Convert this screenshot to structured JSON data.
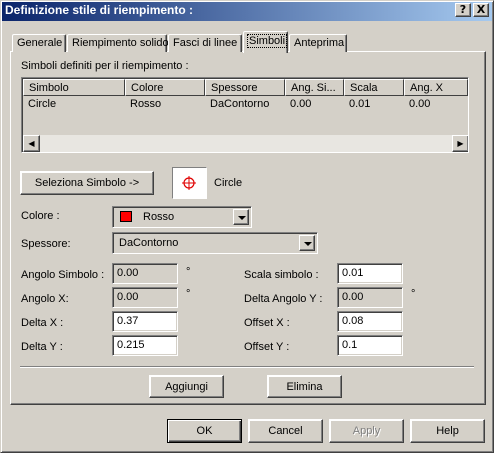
{
  "window": {
    "title": "Definizione stile di riempimento :",
    "help_caption": "?",
    "close_caption": "X"
  },
  "tabs": [
    {
      "label": "Generale"
    },
    {
      "label": "Riempimento solido"
    },
    {
      "label": "Fasci di linee"
    },
    {
      "label": "Simboli",
      "active": true
    },
    {
      "label": "Anteprima"
    }
  ],
  "symbols_list": {
    "caption": "Simboli definiti per il riempimento :",
    "columns": [
      "Simbolo",
      "Colore",
      "Spessore",
      "Ang. Si...",
      "Scala",
      "Ang. X"
    ],
    "rows": [
      [
        "Circle",
        "Rosso",
        "DaContorno",
        "0.00",
        "0.01",
        "0.00"
      ]
    ],
    "scroll_left": "◀",
    "scroll_right": "▶"
  },
  "symbol_picker": {
    "button_label": "Seleziona Simbolo ->",
    "preview_icon": "crosshair-circle-icon",
    "selected_name": "Circle"
  },
  "colore": {
    "label": "Colore :",
    "value": "Rosso",
    "swatch_color": "#ff0000"
  },
  "spessore": {
    "label": "Spessore:",
    "value": "DaContorno"
  },
  "fields_left": [
    {
      "label": "Angolo Simbolo :",
      "value": "0.00",
      "unit": "°"
    },
    {
      "label": "Angolo X:",
      "value": "0.00",
      "unit": "°"
    },
    {
      "label": "Delta X :",
      "value": "0.37"
    },
    {
      "label": "Delta Y :",
      "value": "0.215"
    }
  ],
  "fields_right": [
    {
      "label": "Scala simbolo :",
      "value": "0.01"
    },
    {
      "label": "Delta Angolo Y :",
      "value": "0.00",
      "unit": "°"
    },
    {
      "label": "Offset X :",
      "value": "0.08"
    },
    {
      "label": "Offset Y :",
      "value": "0.1"
    }
  ],
  "actions": {
    "add_label": "Aggiungi",
    "delete_label": "Elimina"
  },
  "footer": {
    "ok_label": "OK",
    "cancel_label": "Cancel",
    "apply_label": "Apply",
    "help_label": "Help"
  },
  "colors": {
    "face": "#d4d0c8",
    "title_start": "#0a246a",
    "title_end": "#a6caf0",
    "accent_red": "#ff0000"
  }
}
